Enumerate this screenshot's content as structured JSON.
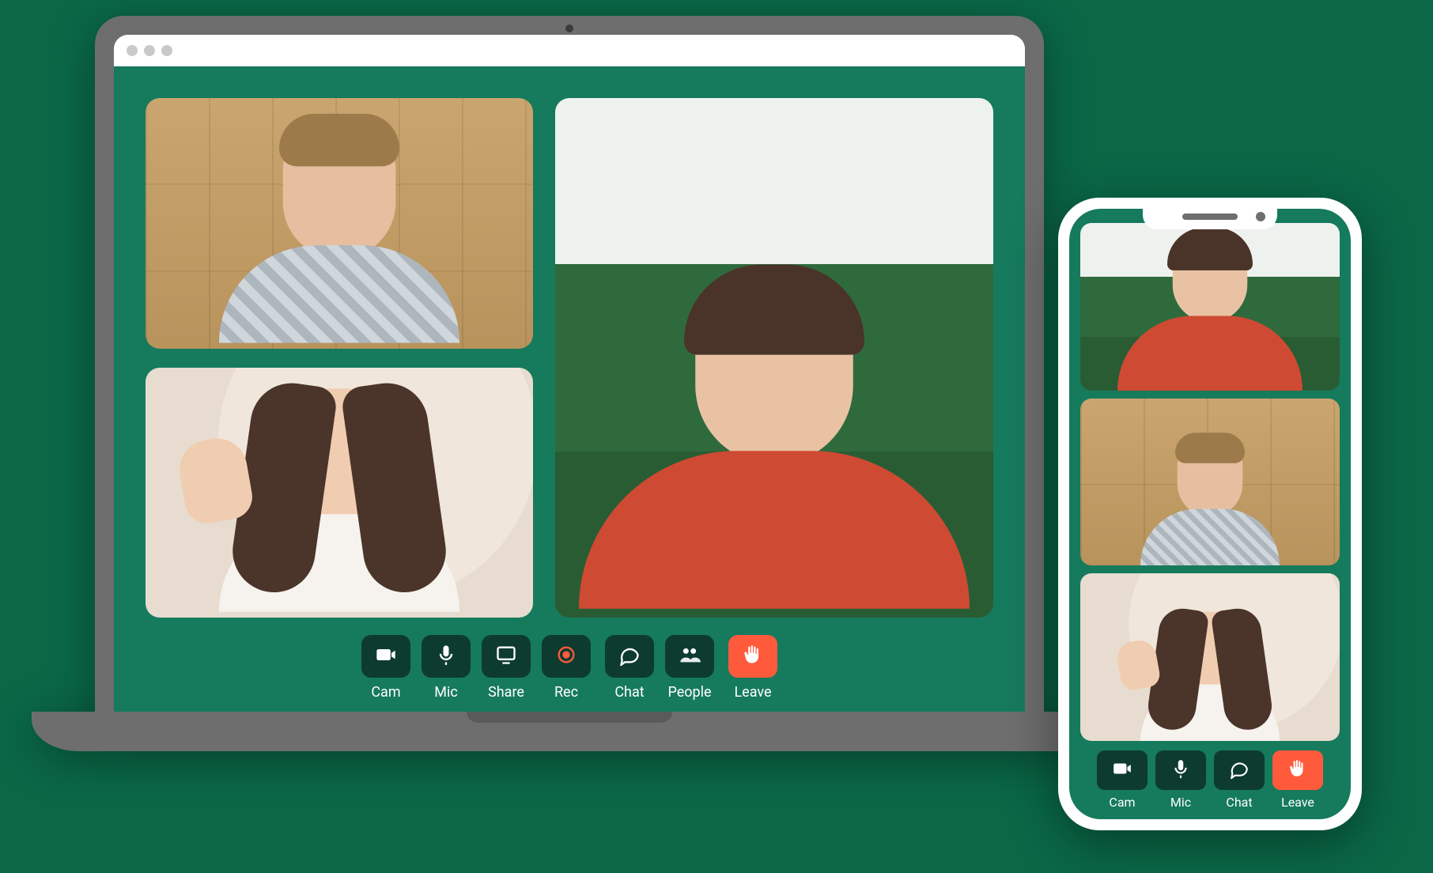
{
  "colors": {
    "app_bg": "#167a5d",
    "button_bg": "#0e3b30",
    "leave_bg": "#ff5a3c",
    "rec_fg": "#ff5a3c"
  },
  "desktop": {
    "toolbar": {
      "cam": "Cam",
      "mic": "Mic",
      "share": "Share",
      "rec": "Rec",
      "chat": "Chat",
      "people": "People",
      "leave": "Leave"
    }
  },
  "mobile": {
    "toolbar": {
      "cam": "Cam",
      "mic": "Mic",
      "chat": "Chat",
      "leave": "Leave"
    }
  }
}
